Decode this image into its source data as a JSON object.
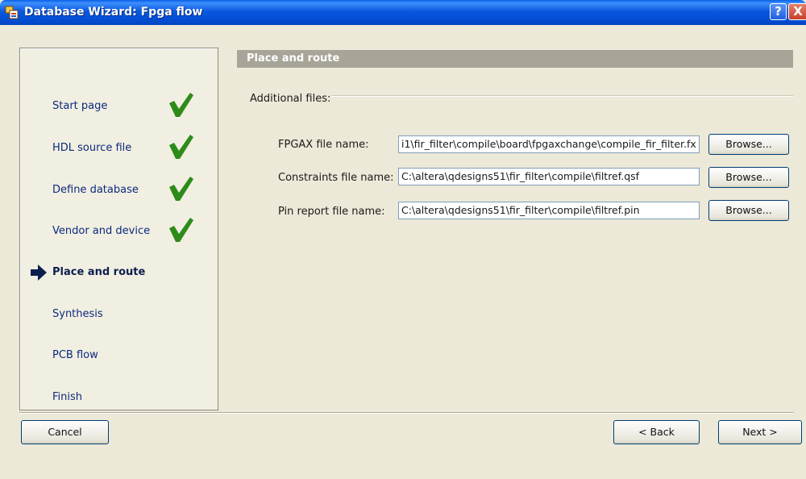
{
  "window": {
    "title": "Database Wizard: Fpga flow",
    "help_label": "?",
    "close_label": "X"
  },
  "nav": {
    "items": [
      {
        "label": "Start page",
        "state": "done"
      },
      {
        "label": "HDL source file",
        "state": "done"
      },
      {
        "label": "Define database",
        "state": "done"
      },
      {
        "label": "Vendor and device",
        "state": "done"
      },
      {
        "label": "Place and route",
        "state": "current"
      },
      {
        "label": "Synthesis",
        "state": "pending"
      },
      {
        "label": "PCB flow",
        "state": "pending"
      },
      {
        "label": "Finish",
        "state": "pending"
      }
    ],
    "check_icon": "green-checkmark-icon",
    "current_icon": "right-arrow-icon"
  },
  "main": {
    "section_title": "Place and route",
    "group_label": "Additional files:",
    "rows": [
      {
        "label": "FPGAX file name:",
        "value": "i1\\fir_filter\\compile\\board\\fpgaxchange\\compile_fir_filter.fx",
        "button": "Browse..."
      },
      {
        "label": "Constraints file name:",
        "value": "C:\\altera\\qdesigns51\\fir_filter\\compile\\filtref.qsf",
        "button": "Browse..."
      },
      {
        "label": "Pin report file name:",
        "value": "C:\\altera\\qdesigns51\\fir_filter\\compile\\filtref.pin",
        "button": "Browse..."
      }
    ]
  },
  "footer": {
    "cancel_label": "Cancel",
    "back_label": "< Back",
    "next_label": "Next >"
  },
  "colors": {
    "titlebar": "#0451d8",
    "check": "#2e8b1a",
    "section_header": "#a8a497"
  }
}
